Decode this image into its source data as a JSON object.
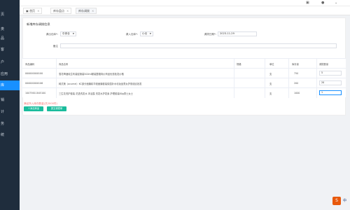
{
  "sidebar": {
    "items": [
      {
        "label": "页"
      },
      {
        "label": "类"
      },
      {
        "label": "品"
      },
      {
        "label": "客"
      },
      {
        "label": "户"
      },
      {
        "label": "应用"
      },
      {
        "label": "库"
      },
      {
        "label": "销"
      },
      {
        "label": "计"
      },
      {
        "label": "务"
      },
      {
        "label": "统"
      }
    ]
  },
  "topbar": {
    "icons": [
      "monitor-icon",
      "user-icon",
      "chevron-down-icon"
    ]
  },
  "tabs": [
    {
      "label": "首页",
      "close": "×"
    },
    {
      "label": "库存盘点",
      "close": "×"
    },
    {
      "label": "库存调拨",
      "close": "×"
    }
  ],
  "form": {
    "title": "新增库存调拨信息",
    "out_label": "调出仓库*:",
    "out_value": "中央仓",
    "in_label": "调入仓库*:",
    "in_value": "小仓",
    "date_label": "调拨日期*:",
    "date_value": "2023-11-29",
    "remark_label": "备注"
  },
  "table": {
    "headers": [
      "商品编码",
      "商品名称",
      "规格",
      "单位",
      "库存量",
      "调拨数量"
    ],
    "rows": [
      {
        "code": "000000000100",
        "name": "雪花啤酒纯生听装促销装500ml罐装整箱特价商品优惠批发价格",
        "spec": "",
        "unit": "支",
        "stock": "750",
        "qty": "5"
      },
      {
        "code": "000000000106",
        "name": "韩式美（acumei）KC部分面膜精华液面膜套装保湿补水化妆品男女护肤组合批发",
        "spec": "",
        "unit": "支",
        "stock": "200",
        "qty": "20"
      },
      {
        "code": "10075611845100",
        "name": "三生花洗护套装 花语洗发水 沐浴露 洗发水护发素 护理套装80g男士女士",
        "spec": "",
        "unit": "支",
        "stock": "1000",
        "qty": "1"
      }
    ]
  },
  "footer": {
    "warning": "满足所入库存数量(共2000件)",
    "add_button": "＋添加商品",
    "confirm_button": "提交调拨单"
  },
  "float": {
    "badge": "S",
    "text": "中"
  }
}
